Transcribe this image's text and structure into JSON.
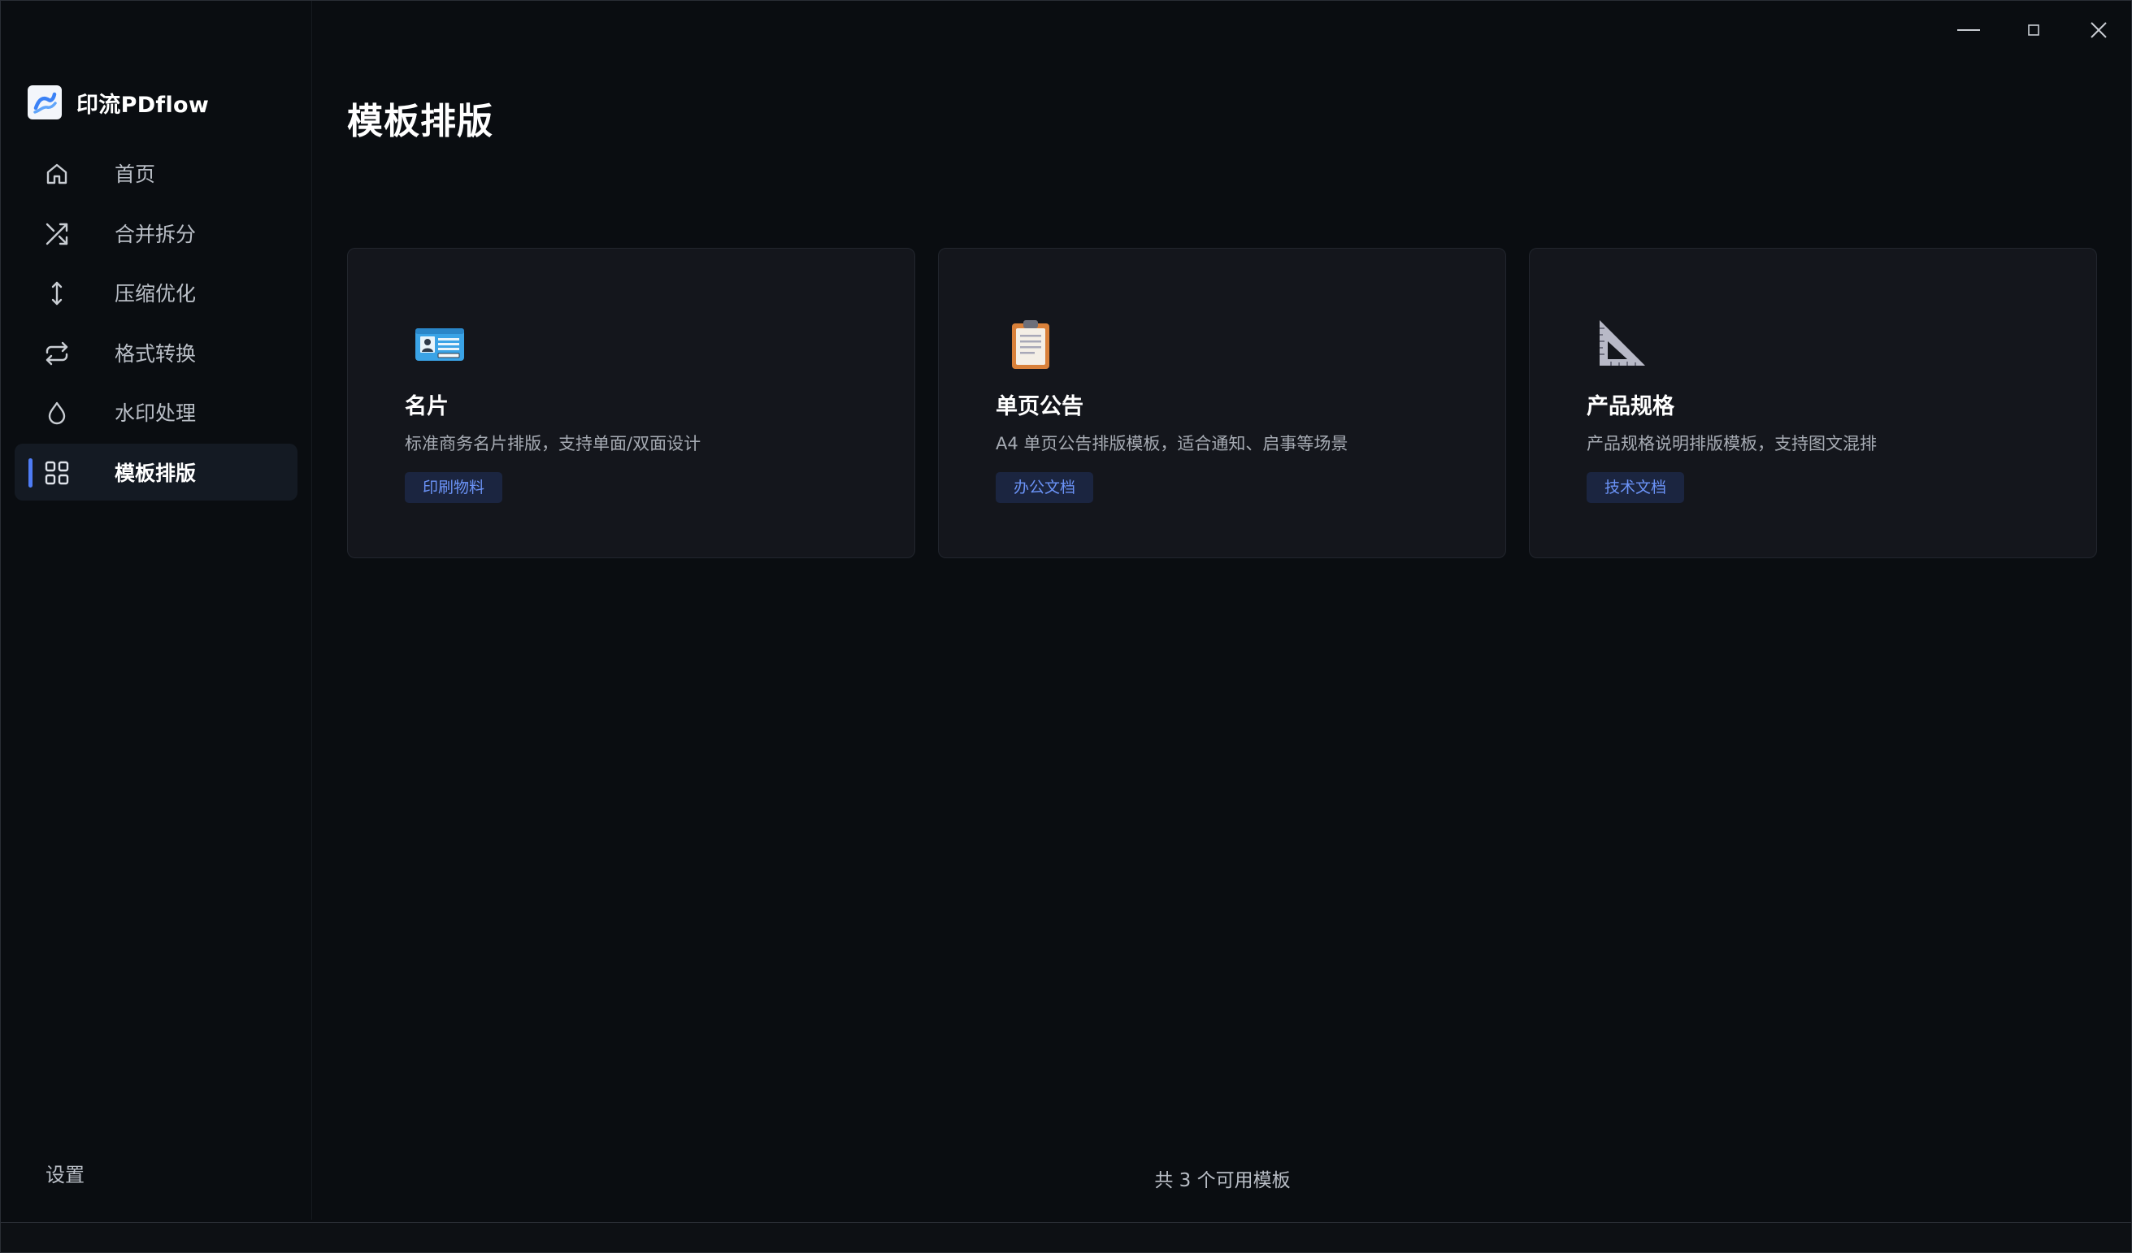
{
  "window": {
    "controls": [
      "minimize",
      "maximize",
      "close"
    ]
  },
  "brand": {
    "name": "印流PDflow",
    "logo_icon": "pdflow-logo-icon"
  },
  "sidebar": {
    "items": [
      {
        "label": "首页",
        "icon": "home-icon",
        "active": false
      },
      {
        "label": "合并拆分",
        "icon": "shuffle-icon",
        "active": false
      },
      {
        "label": "压缩优化",
        "icon": "vertical-arrows-icon",
        "active": false
      },
      {
        "label": "格式转换",
        "icon": "repeat-icon",
        "active": false
      },
      {
        "label": "水印处理",
        "icon": "droplet-icon",
        "active": false
      },
      {
        "label": "模板排版",
        "icon": "grid-icon",
        "active": true
      }
    ],
    "settings_label": "设置"
  },
  "main": {
    "title": "模板排版",
    "cards": [
      {
        "title": "名片",
        "description": "标准商务名片排版，支持单面/双面设计",
        "tag": "印刷物料",
        "icon": "id-card-icon"
      },
      {
        "title": "单页公告",
        "description": "A4 单页公告排版模板，适合通知、启事等场景",
        "tag": "办公文档",
        "icon": "clipboard-icon"
      },
      {
        "title": "产品规格",
        "description": "产品规格说明排版模板，支持图文混排",
        "tag": "技术文档",
        "icon": "triangular-ruler-icon"
      }
    ],
    "footer": "共 3 个可用模板"
  },
  "colors": {
    "background": "#0a0d11",
    "card": "#14161c",
    "accent": "#4e7cf5",
    "tag_text": "#6b93f7",
    "tag_bg": "#1b2540"
  }
}
